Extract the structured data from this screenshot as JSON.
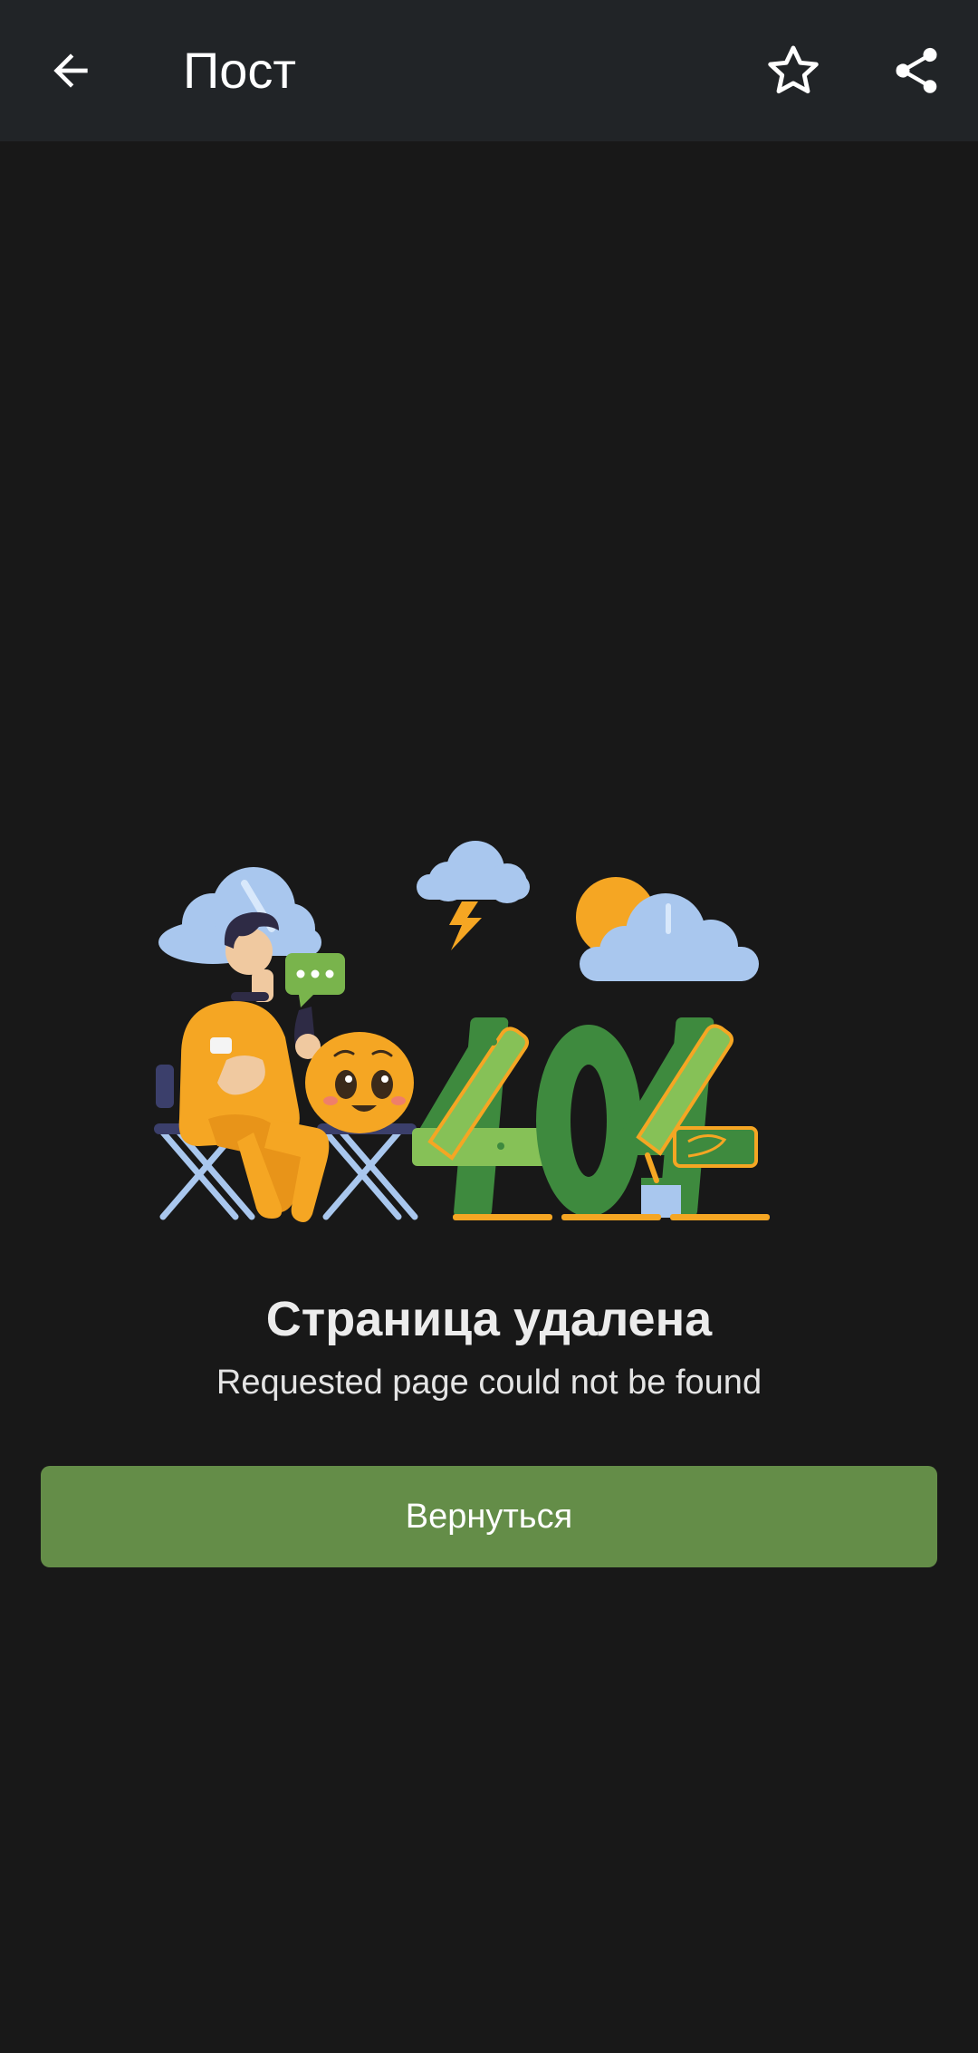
{
  "header": {
    "title": "Пост",
    "back_icon": "arrow-left-icon",
    "favorite_icon": "star-outline-icon",
    "share_icon": "share-icon"
  },
  "error": {
    "illustration_text": "404",
    "heading": "Страница удалена",
    "message": "Requested page could not be found",
    "button_label": "Вернуться"
  },
  "colors": {
    "background": "#181818",
    "topbar": "#212427",
    "button": "#648d48",
    "text": "#ececec"
  }
}
